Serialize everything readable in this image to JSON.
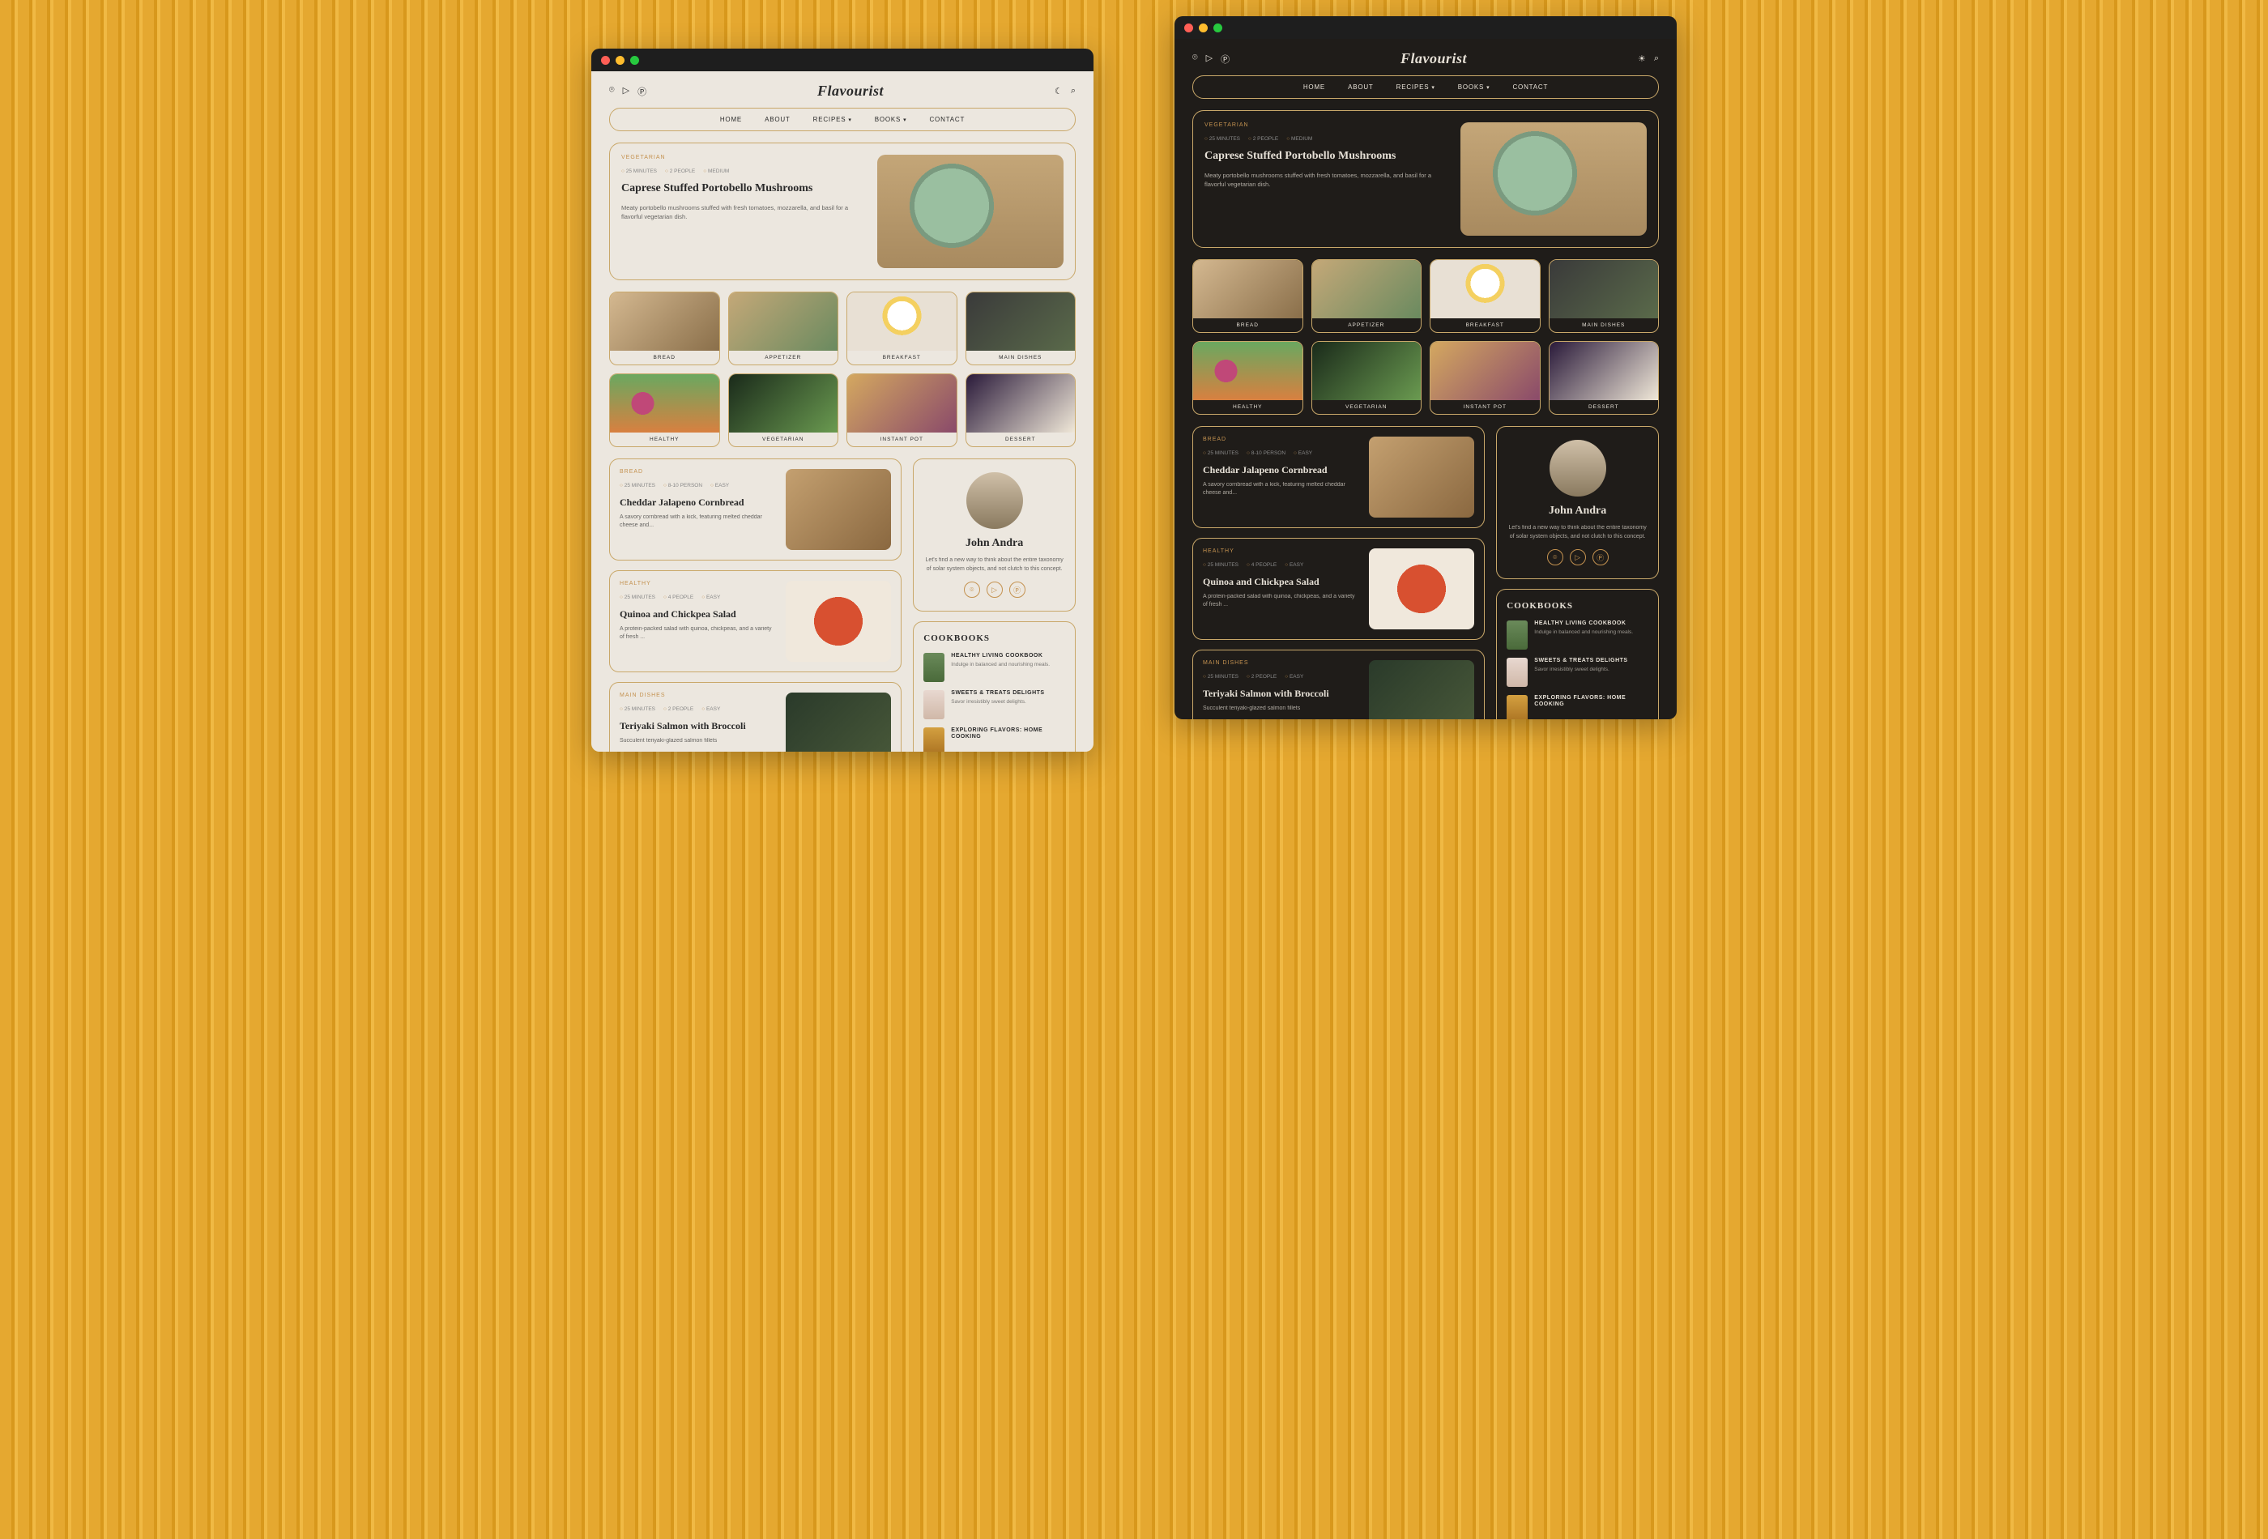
{
  "brand": "Flavourist",
  "nav": [
    "HOME",
    "ABOUT",
    "RECIPES",
    "BOOKS",
    "CONTACT"
  ],
  "hero": {
    "tag": "VEGETARIAN",
    "meta": [
      "25 MINUTES",
      "2 PEOPLE",
      "MEDIUM"
    ],
    "title": "Caprese Stuffed Portobello Mushrooms",
    "desc": "Meaty portobello mushrooms stuffed with fresh tomatoes, mozzarella, and basil for a flavorful vegetarian dish."
  },
  "categories": [
    "BREAD",
    "APPETIZER",
    "BREAKFAST",
    "MAIN DISHES",
    "HEALTHY",
    "VEGETARIAN",
    "INSTANT POT",
    "DESSERT"
  ],
  "recipes": [
    {
      "tag": "BREAD",
      "meta": [
        "25 MINUTES",
        "8-10 PERSON",
        "EASY"
      ],
      "title": "Cheddar Jalapeno Cornbread",
      "desc": "A savory cornbread with a kick, featuring melted cheddar cheese and..."
    },
    {
      "tag": "HEALTHY",
      "meta": [
        "25 MINUTES",
        "4 PEOPLE",
        "EASY"
      ],
      "title": "Quinoa and Chickpea Salad",
      "desc": "A protein-packed salad with quinoa, chickpeas, and a variety of fresh ..."
    },
    {
      "tag": "MAIN DISHES",
      "meta": [
        "25 MINUTES",
        "2 PEOPLE",
        "EASY"
      ],
      "title": "Teriyaki Salmon with Broccoli",
      "desc": "Succulent teriyaki-glazed salmon fillets"
    }
  ],
  "author": {
    "name": "John Andra",
    "bio": "Let's find a new way to think about the entire taxonomy of solar system objects, and not clutch to this concept."
  },
  "cookbooks_title": "COOKBOOKS",
  "cookbooks": [
    {
      "title": "HEALTHY LIVING COOKBOOK",
      "desc": "Indulge in balanced and nourishing meals."
    },
    {
      "title": "SWEETS & TREATS DELIGHTS",
      "desc": "Savor irresistibly sweet delights."
    },
    {
      "title": "EXPLORING FLAVORS: HOME COOKING",
      "desc": ""
    }
  ]
}
